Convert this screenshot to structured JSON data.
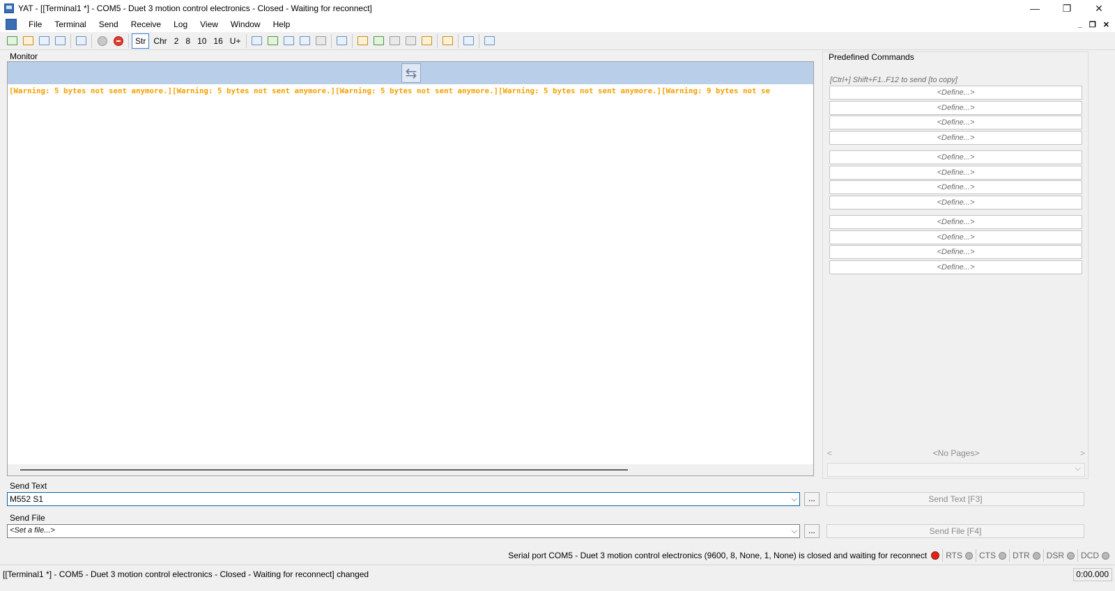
{
  "window": {
    "title": "YAT - [[Terminal1 *] - COM5 - Duet 3 motion control electronics - Closed - Waiting for reconnect]",
    "minimize": "—",
    "restore": "❐",
    "close": "✕"
  },
  "menu": {
    "items": [
      "File",
      "Terminal",
      "Send",
      "Receive",
      "Log",
      "View",
      "Window",
      "Help"
    ],
    "mdi_minimize": "_",
    "mdi_restore": "❐",
    "mdi_close": "✕"
  },
  "toolbar": {
    "radix": [
      "Str",
      "Chr",
      "2",
      "8",
      "10",
      "16",
      "U+"
    ],
    "radix_selected": "Str"
  },
  "monitor": {
    "label": "Monitor",
    "swap_icon": "⇆",
    "text": "[Warning: 5 bytes not sent anymore.][Warning: 5 bytes not sent anymore.][Warning: 5 bytes not sent anymore.][Warning: 5 bytes not sent anymore.][Warning: 9 bytes not se",
    "text_color": "#f5a000"
  },
  "predefined": {
    "label": "Predefined Commands",
    "hint": "[Ctrl+] Shift+F1..F12 to send [to copy]",
    "buttons": [
      "<Define...>",
      "<Define...>",
      "<Define...>",
      "<Define...>",
      "<Define...>",
      "<Define...>",
      "<Define...>",
      "<Define...>",
      "<Define...>",
      "<Define...>",
      "<Define...>",
      "<Define...>"
    ],
    "pager_prev": "<",
    "pager_text": "<No Pages>",
    "pager_next": ">"
  },
  "send_text": {
    "label": "Send Text",
    "value": "M552 S1",
    "browse": "...",
    "button": "Send Text [F3]"
  },
  "send_file": {
    "label": "Send File",
    "value": "<Set a file...>",
    "browse": "...",
    "button": "Send File [F4]"
  },
  "status": {
    "port_message": "Serial port COM5 - Duet 3 motion control electronics (9600, 8, None, 1, None) is closed and waiting for reconnect",
    "signals": [
      "RTS",
      "CTS",
      "DTR",
      "DSR",
      "DCD"
    ],
    "led_color": "#e0221a",
    "bottom_message": "[[Terminal1 *] - COM5 - Duet 3 motion control electronics - Closed - Waiting for reconnect] changed",
    "timer": "0:00.000"
  }
}
